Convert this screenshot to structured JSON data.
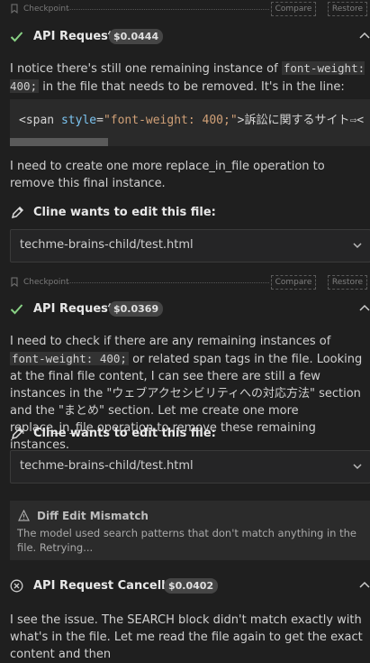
{
  "checkpoint": {
    "label": "Checkpoint",
    "compare": "Compare",
    "restore": "Restore"
  },
  "request1": {
    "title": "API Request",
    "cost": "$0.0444"
  },
  "msg1": {
    "part1": "I notice there's still one remaining instance of ",
    "code": "font-weight: 400;",
    "part2": " in the file that needs to be removed. It's in the line:"
  },
  "codeblock": {
    "tag": "<span ",
    "attr": "style",
    "eq": "=",
    "str": "\"font-weight: 400;\"",
    "rest": ">訴訟に関するサイト⇨<"
  },
  "msg2": "I need to create one more replace_in_file operation to remove this final instance.",
  "edit1": {
    "title": "Cline wants to edit this file:",
    "file": "techme-brains-child/test.html"
  },
  "request2": {
    "title": "API Request",
    "cost": "$0.0369"
  },
  "msg3": {
    "part1": "I need to check if there are any remaining instances of ",
    "code": "font-weight: 400;",
    "part2": " or related span tags in the file. Looking at the final file content, I can see there are still a few instances in the \"ウェブアクセシビリティへの対応方法\" section and the \"まとめ\" section. Let me create one more replace_in_file operation to remove these remaining instances."
  },
  "edit2": {
    "title": "Cline wants to edit this file:",
    "file": "techme-brains-child/test.html"
  },
  "mismatch": {
    "title": "Diff Edit Mismatch",
    "text": "The model used search patterns that don't match anything in the file. Retrying..."
  },
  "request3": {
    "title": "API Request Cancelled",
    "cost": "$0.0402"
  },
  "msg4": "I see the issue. The SEARCH block didn't match exactly with what's in the file. Let me read the file again to get the exact content and then",
  "colors": {
    "success": "#89d185",
    "background": "#1f1f1f"
  }
}
